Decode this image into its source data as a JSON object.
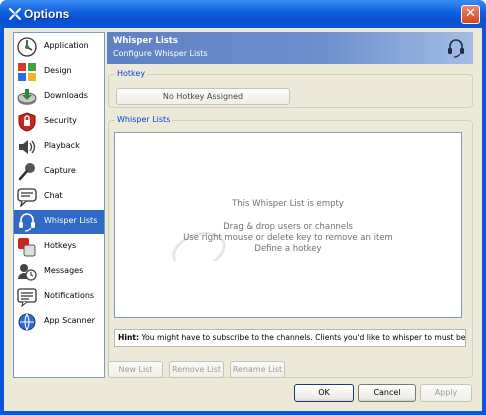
{
  "window": {
    "title": "Options",
    "close_glyph": "✕"
  },
  "sidebar": {
    "items": [
      {
        "label": "Application",
        "icon": "application-icon"
      },
      {
        "label": "Design",
        "icon": "design-icon"
      },
      {
        "label": "Downloads",
        "icon": "downloads-icon"
      },
      {
        "label": "Security",
        "icon": "security-icon"
      },
      {
        "label": "Playback",
        "icon": "playback-icon"
      },
      {
        "label": "Capture",
        "icon": "capture-icon"
      },
      {
        "label": "Chat",
        "icon": "chat-icon"
      },
      {
        "label": "Whisper Lists",
        "icon": "whisper-icon",
        "selected": true
      },
      {
        "label": "Hotkeys",
        "icon": "hotkeys-icon"
      },
      {
        "label": "Messages",
        "icon": "messages-icon"
      },
      {
        "label": "Notifications",
        "icon": "notifications-icon"
      },
      {
        "label": "App Scanner",
        "icon": "app-scanner-icon"
      }
    ]
  },
  "header": {
    "title": "Whisper Lists",
    "subtitle": "Configure Whisper Lists",
    "icon": "headset-icon"
  },
  "hotkey": {
    "group_label": "Hotkey",
    "button_label": "No Hotkey Assigned"
  },
  "whisper_lists": {
    "group_label": "Whisper Lists",
    "empty_title": "This Whisper List is empty",
    "empty_lines": [
      "Drag & drop users or channels",
      "Use right mouse or delete key to remove an item",
      "Define a hotkey"
    ],
    "watermark": "CHIP"
  },
  "hint": {
    "prefix": "Hint:",
    "text": " You might have to subscribe to the channels. Clients you'd like to whisper to must be visible."
  },
  "list_buttons": {
    "new": "New List",
    "remove": "Remove List",
    "rename": "Rename List"
  },
  "dialog_buttons": {
    "ok": "OK",
    "cancel": "Cancel",
    "apply": "Apply"
  },
  "colors": {
    "accent": "#316ac5",
    "title_bar": "#0a56d8",
    "group_label": "#0046d5"
  }
}
